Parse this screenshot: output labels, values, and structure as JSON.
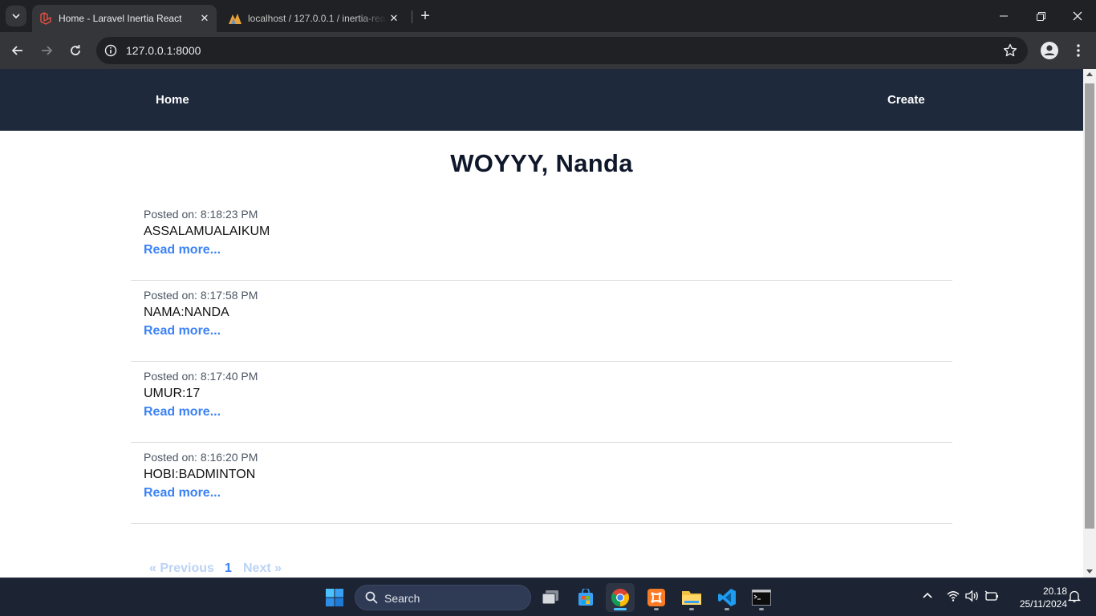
{
  "browser": {
    "tabs": [
      {
        "title": "Home - Laravel Inertia React",
        "active": true
      },
      {
        "title": "localhost / 127.0.0.1 / inertia-react",
        "active": false
      }
    ],
    "url": "127.0.0.1:8000"
  },
  "site": {
    "nav": {
      "home_label": "Home",
      "create_label": "Create"
    },
    "heading": "WOYYY, Nanda",
    "posts": [
      {
        "posted": "Posted on: 8:18:23 PM",
        "title": "ASSALAMUALAIKUM",
        "link": "Read more..."
      },
      {
        "posted": "Posted on: 8:17:58 PM",
        "title": "NAMA:NANDA",
        "link": "Read more..."
      },
      {
        "posted": "Posted on: 8:17:40 PM",
        "title": "UMUR:17",
        "link": "Read more..."
      },
      {
        "posted": "Posted on: 8:16:20 PM",
        "title": "HOBI:BADMINTON",
        "link": "Read more..."
      }
    ],
    "pagination": {
      "prev": "« Previous",
      "current": "1",
      "next": "Next »"
    }
  },
  "taskbar": {
    "search_label": "Search",
    "time": "20.18",
    "date": "25/11/2024",
    "apps": [
      "windows-start-icon",
      "task-view-icon",
      "microsoft-store-icon",
      "chrome-icon",
      "xampp-icon",
      "file-explorer-icon",
      "vscode-icon",
      "terminal-icon"
    ]
  },
  "colors": {
    "nav_bg": "#1e293b",
    "link_blue": "#3b82f6",
    "heading": "#0f172a"
  }
}
